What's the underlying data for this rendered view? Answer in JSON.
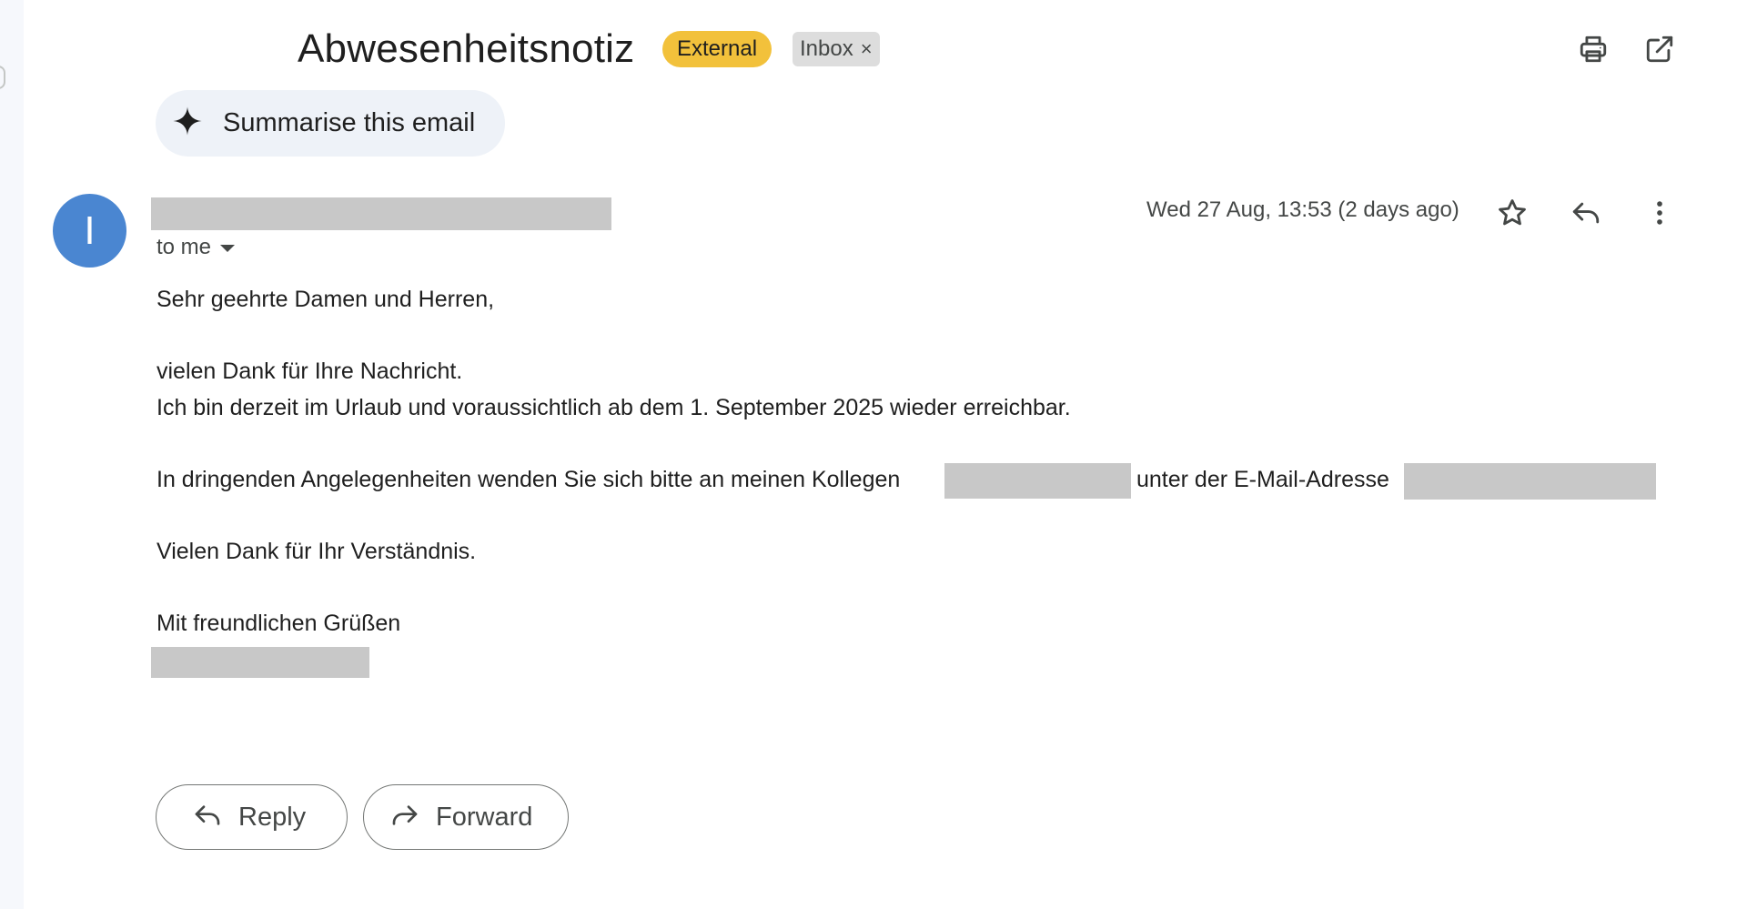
{
  "email": {
    "subject": "Abwesenheitsnotiz",
    "labels": {
      "external": "External",
      "inbox": "Inbox",
      "inbox_remove": "×"
    },
    "summarise_label": "Summarise this email",
    "sender_initial": "I",
    "recipient_label": "to me",
    "date": "Wed 27 Aug, 13:53 (2 days ago)",
    "body": {
      "greeting": "Sehr geehrte Damen und Herren,",
      "line1": "vielen Dank für Ihre Nachricht.",
      "line2": "Ich bin derzeit im Urlaub und voraussichtlich ab dem 1. September 2025 wieder erreichbar.",
      "line3_part1": "In dringenden Angelegenheiten wenden Sie sich bitte an meinen Kollegen",
      "line3_part2": "unter der E-Mail-Adresse",
      "line4": "Vielen Dank für Ihr Verständnis.",
      "closing": "Mit freundlichen Grüßen"
    },
    "actions": {
      "reply": "Reply",
      "forward": "Forward"
    }
  },
  "colors": {
    "avatar": "#4a86d1",
    "external_badge": "#f2c13b",
    "inbox_badge": "#dddddd",
    "redaction": "#c8c8c8"
  },
  "icons": {
    "print": "print-icon",
    "open_new_window": "open-in-new-window-icon",
    "sparkle": "sparkle-icon",
    "star": "star-icon",
    "reply": "reply-icon",
    "more": "more-vertical-icon",
    "forward": "forward-icon"
  }
}
